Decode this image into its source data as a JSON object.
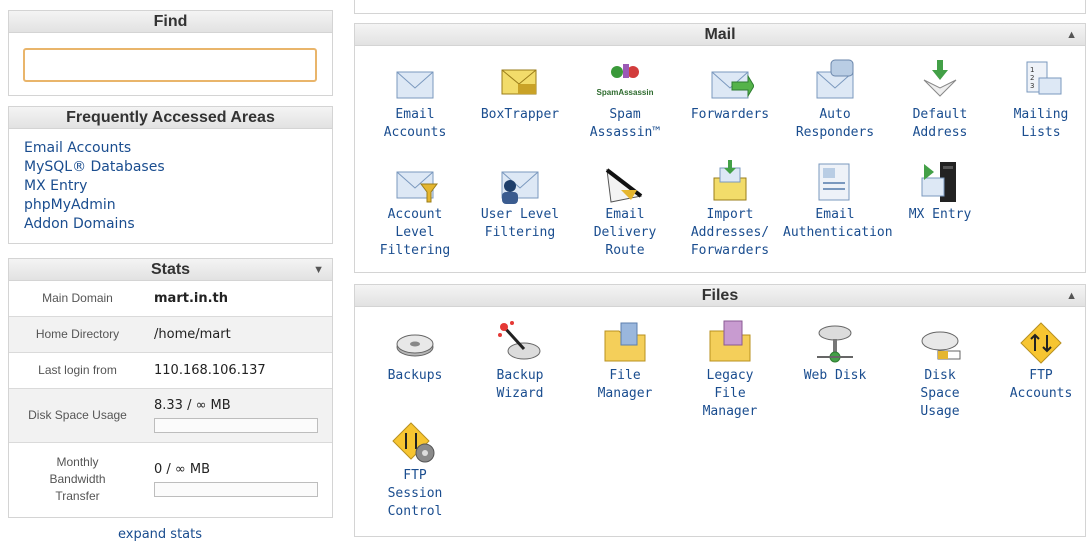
{
  "find": {
    "title": "Find",
    "value": ""
  },
  "faa": {
    "title": "Frequently Accessed Areas",
    "links": [
      "Email Accounts",
      "MySQL® Databases",
      "MX Entry",
      "phpMyAdmin",
      "Addon Domains"
    ]
  },
  "stats": {
    "title": "Stats",
    "toggle_icon": "triangle-down-icon",
    "rows": [
      {
        "label": "Main Domain",
        "value": "mart.in.th"
      },
      {
        "label": "Home Directory",
        "value": "/home/mart"
      },
      {
        "label": "Last login from",
        "value": "110.168.106.137"
      },
      {
        "label": "Disk Space Usage",
        "value": "8.33 / ∞ MB",
        "usage": 0
      },
      {
        "label": "Monthly\nBandwidth\nTransfer",
        "value": "0 / ∞ MB",
        "usage": 0
      }
    ],
    "expand_label": "expand stats"
  },
  "mail": {
    "title": "Mail",
    "toggle_icon": "triangle-up-icon",
    "items": [
      {
        "label": "Email\nAccounts",
        "icon": "envelope-icon"
      },
      {
        "label": "BoxTrapper",
        "icon": "boxtrapper-icon"
      },
      {
        "label": "Spam\nAssassin™",
        "icon": "spamassassin-icon",
        "icon_text": "SpamAssassin"
      },
      {
        "label": "Forwarders",
        "icon": "forward-envelope-icon"
      },
      {
        "label": "Auto\nResponders",
        "icon": "auto-responder-icon"
      },
      {
        "label": "Default\nAddress",
        "icon": "default-address-icon"
      },
      {
        "label": "Mailing\nLists",
        "icon": "mailing-list-icon"
      },
      {
        "label": "Account\nLevel\nFiltering",
        "icon": "account-filter-icon"
      },
      {
        "label": "User Level\nFiltering",
        "icon": "user-filter-icon"
      },
      {
        "label": "Email\nDelivery\nRoute",
        "icon": "delivery-route-icon"
      },
      {
        "label": "Import\nAddresses/\nForwarders",
        "icon": "import-icon"
      },
      {
        "label": "Email\nAuthentication",
        "icon": "authentication-icon"
      },
      {
        "label": "MX Entry",
        "icon": "mx-entry-icon"
      }
    ]
  },
  "files": {
    "title": "Files",
    "toggle_icon": "triangle-up-icon",
    "items": [
      {
        "label": "Backups",
        "icon": "backup-disk-icon"
      },
      {
        "label": "Backup\nWizard",
        "icon": "backup-wizard-icon"
      },
      {
        "label": "File\nManager",
        "icon": "folder-icon"
      },
      {
        "label": "Legacy\nFile\nManager",
        "icon": "legacy-folder-icon"
      },
      {
        "label": "Web Disk",
        "icon": "web-disk-icon"
      },
      {
        "label": "Disk\nSpace\nUsage",
        "icon": "disk-usage-icon"
      },
      {
        "label": "FTP\nAccounts",
        "icon": "ftp-icon"
      },
      {
        "label": "FTP\nSession\nControl",
        "icon": "ftp-session-icon"
      }
    ]
  },
  "colors": {
    "link": "#1a4d8f",
    "find_border": "#e9b56b",
    "header_bg": "#e6e6e6"
  }
}
